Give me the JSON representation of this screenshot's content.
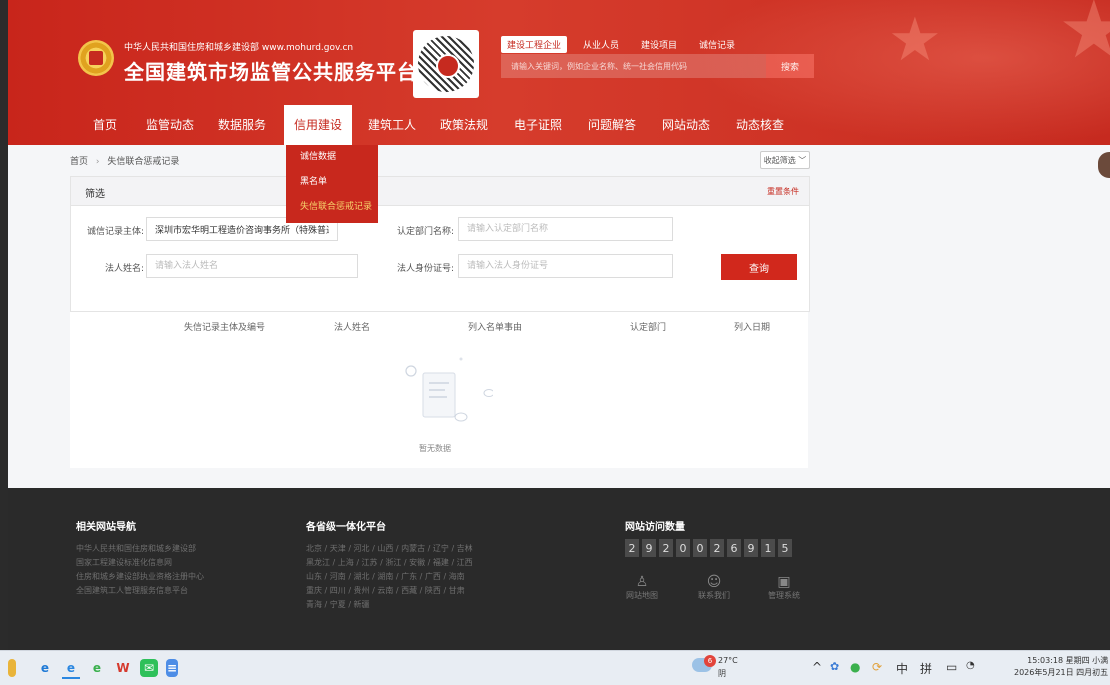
{
  "header": {
    "site_subtitle": "中华人民共和国住房和城乡建设部 www.mohurd.gov.cn",
    "site_title": "全国建筑市场监管公共服务平台",
    "search_tabs": [
      "建设工程企业",
      "从业人员",
      "建设项目",
      "诚信记录"
    ],
    "search_placeholder": "请输入关键词，例如企业名称、统一社会信用代码",
    "search_button": "搜索"
  },
  "nav": {
    "items": [
      "首页",
      "监管动态",
      "数据服务",
      "信用建设",
      "建筑工人",
      "政策法规",
      "电子证照",
      "问题解答",
      "网站动态",
      "动态核查"
    ],
    "active": "信用建设"
  },
  "dropdown": {
    "items": [
      "诚信数据",
      "黑名单",
      "失信联合惩戒记录"
    ],
    "active": "失信联合惩戒记录"
  },
  "breadcrumb": {
    "home": "首页",
    "sep": "›",
    "current": "失信联合惩戒记录"
  },
  "fold_button": "收起筛选 ﹀",
  "filter": {
    "title": "筛选",
    "reset": "重置条件",
    "subject_label": "诚信记录主体:",
    "subject_value": "深圳市宏华明工程造价咨询事务所（特殊普通合伙）",
    "dept_label": "认定部门名称:",
    "dept_placeholder": "请输入认定部门名称",
    "legal_label": "法人姓名:",
    "legal_placeholder": "请输入法人姓名",
    "id_label": "法人身份证号:",
    "id_placeholder": "请输入法人身份证号",
    "query_button": "查询"
  },
  "table": {
    "columns": [
      "失信记录主体及编号",
      "法人姓名",
      "列入名单事由",
      "认定部门",
      "列入日期"
    ],
    "empty_text": "暂无数据"
  },
  "footer": {
    "nav_title": "相关网站导航",
    "nav_links": [
      "中华人民共和国住房和城乡建设部",
      "国家工程建设标准化信息网",
      "住房和城乡建设部执业资格注册中心",
      "全国建筑工人管理服务信息平台"
    ],
    "province_title": "各省级一体化平台",
    "province_lines": [
      "北京 / 天津 / 河北 / 山西 / 内蒙古 / 辽宁 / 吉林",
      "黑龙江 / 上海 / 江苏 / 浙江 / 安徽 / 福建 / 江西",
      "山东 / 河南 / 湖北 / 湖南 / 广东 / 广西 / 海南",
      "重庆 / 四川 / 贵州 / 云南 / 西藏 / 陕西 / 甘肃",
      "青海 / 宁夏 / 新疆"
    ],
    "visits_title": "网站访问数量",
    "visit_digits": [
      "2",
      "9",
      "2",
      "0",
      "0",
      "2",
      "6",
      "9",
      "1",
      "5"
    ],
    "links": [
      "网站地图",
      "联系我们",
      "管理系统"
    ]
  },
  "taskbar": {
    "weather_badge": "6",
    "temperature": "27°C",
    "weather": "阴",
    "ime1": "中",
    "ime2": "拼",
    "time": "15:03:18 星期四 小满",
    "date": "2026年5月21日 四月初五"
  }
}
